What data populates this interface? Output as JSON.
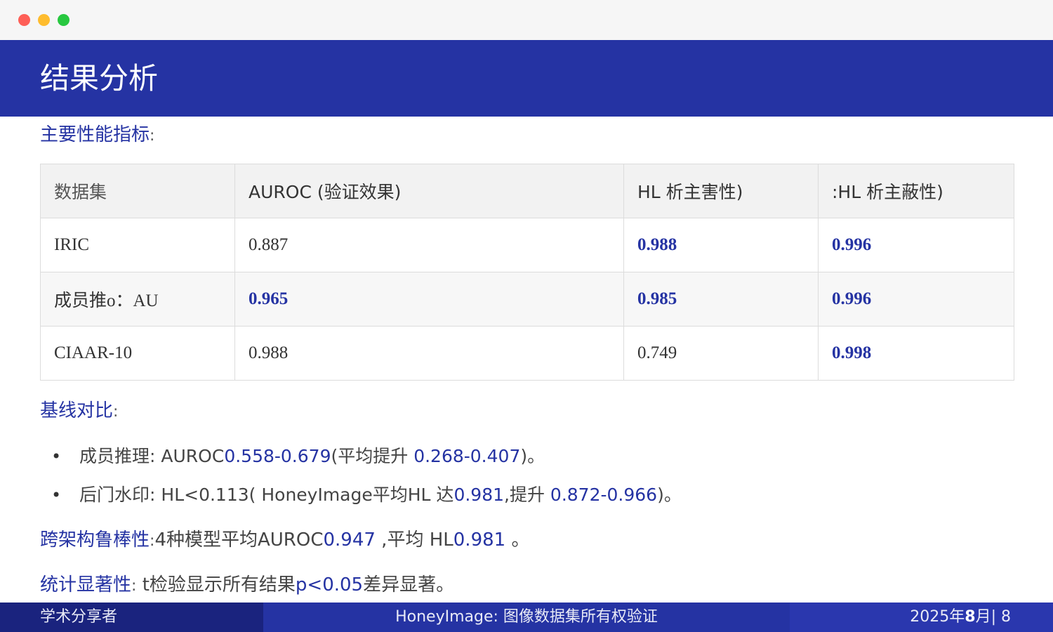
{
  "window": {
    "controls": [
      "close",
      "minimize",
      "maximize"
    ]
  },
  "slide": {
    "title": "结果分析",
    "sections": {
      "metrics": {
        "label": "主要性能指标",
        "colon": ":"
      },
      "baseline": {
        "label": "基线对比",
        "colon": ":"
      },
      "robustness": {
        "label": "跨架构鲁棒性",
        "colon": ":",
        "t1": "4种模型平均AUROC",
        "v1": "0.947",
        "t2": " ,平均   HL",
        "v2": "0.981",
        "t3": " 。"
      },
      "significance": {
        "label": "统计显著性",
        "colon": ":",
        "t1": " t检验显示所有结果",
        "v1": "p<0.05",
        "t2": "差异显著。"
      }
    },
    "table": {
      "headers": [
        "数据集",
        "AUROC (验证效果)",
        "HL 析主害性)",
        ":HL  析主蔽性)"
      ],
      "rows": [
        [
          "IRIC",
          "0.887",
          "0.988",
          "0.996"
        ],
        [
          "成员推o：AU",
          "0.965",
          "0.985",
          "0.996"
        ],
        [
          "CIAAR-10",
          "0.988",
          "0.749",
          "0.998"
        ]
      ]
    },
    "bullets": [
      {
        "label": "成员推理",
        "colon": ":",
        "t1": " AUROC",
        "v1": "0.558-0.679",
        "t2": "(平均提升   ",
        "v2": "0.268-0.407",
        "t3": ")。"
      },
      {
        "label": "后门水印",
        "colon": ":",
        "t1": " HL<0.113(   HoneyImage平均HL 达",
        "v1": "0.981",
        "t2": ",提升   ",
        "v2": "0.872-0.966",
        "t3": ")。"
      }
    ]
  },
  "footer": {
    "left": "学术分享者",
    "center": "HoneyImage: 图像数据集所有权验证",
    "right_prefix": "2025年",
    "right_month": "8",
    "right_suffix": "月| 8"
  },
  "colors": {
    "accent": "#2533a3",
    "footer_left": "#1a237e",
    "footer_right": "#2a37ae",
    "best_value": "#2533a3"
  }
}
